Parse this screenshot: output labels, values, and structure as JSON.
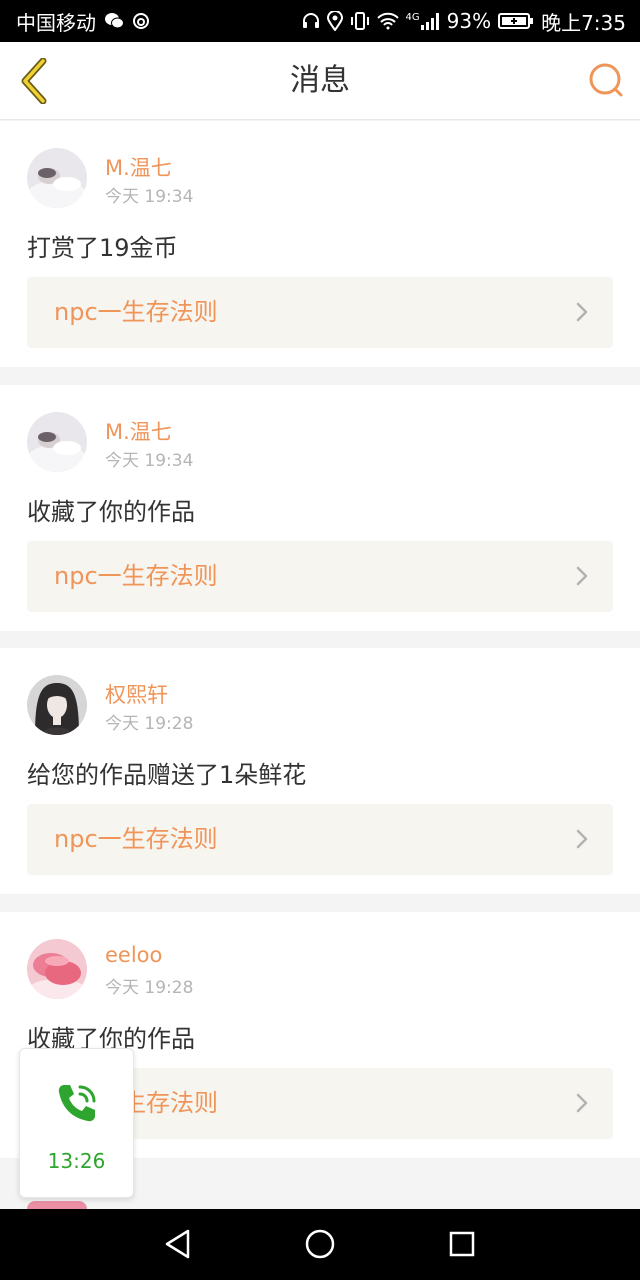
{
  "status_bar": {
    "carrier": "中国移动",
    "network": "4G",
    "battery": "93%",
    "time": "晚上7:35",
    "icons": [
      "wechat-icon",
      "sync-icon",
      "headset-icon",
      "location-icon",
      "vibrate-icon",
      "wifi-icon",
      "signal-icon",
      "battery-icon"
    ]
  },
  "header": {
    "title": "消息",
    "back_icon": "chevron-left-icon",
    "search_icon": "search-icon"
  },
  "accent_color": "#f0955a",
  "messages": [
    {
      "user": "M.温七",
      "time": "今天 19:34",
      "action": "打赏了19金币",
      "work": "npc一生存法则"
    },
    {
      "user": "M.温七",
      "time": "今天 19:34",
      "action": "收藏了你的作品",
      "work": "npc一生存法则"
    },
    {
      "user": "权熙轩",
      "time": "今天 19:28",
      "action": "给您的作品赠送了1朵鲜花",
      "work": "npc一生存法则"
    },
    {
      "user": "eeloo",
      "time": "今天 19:28",
      "action": "收藏了你的作品",
      "work": "生存法则"
    }
  ],
  "call_widget": {
    "icon": "phone-call-icon",
    "timer": "13:26"
  },
  "nav_bar": {
    "icons": [
      "back-triangle-icon",
      "home-circle-icon",
      "recents-square-icon"
    ]
  }
}
